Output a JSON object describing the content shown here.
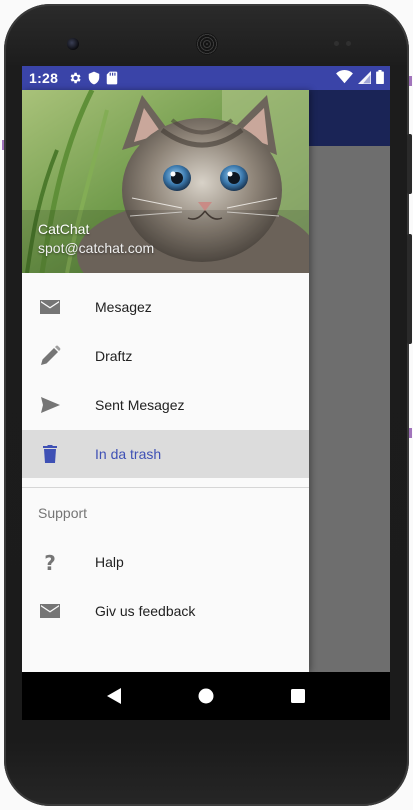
{
  "status_bar": {
    "time": "1:28"
  },
  "drawer": {
    "header": {
      "app_name": "CatChat",
      "email": "spot@catchat.com"
    },
    "items": [
      {
        "label": "Mesagez",
        "icon": "mail-icon"
      },
      {
        "label": "Draftz",
        "icon": "pencil-icon"
      },
      {
        "label": "Sent Mesagez",
        "icon": "send-icon"
      },
      {
        "label": "In da trash",
        "icon": "trash-icon",
        "selected": true
      }
    ],
    "support_header": "Support",
    "support_items": [
      {
        "label": "Halp",
        "icon": "help-icon"
      },
      {
        "label": "Giv us feedback",
        "icon": "mail-icon"
      }
    ]
  },
  "colors": {
    "status_bar": "#3a44a8",
    "toolbar": "#1a2456",
    "accent": "#3f51b5",
    "selected_bg": "#dcdcdc",
    "icon_gray": "#757575"
  }
}
